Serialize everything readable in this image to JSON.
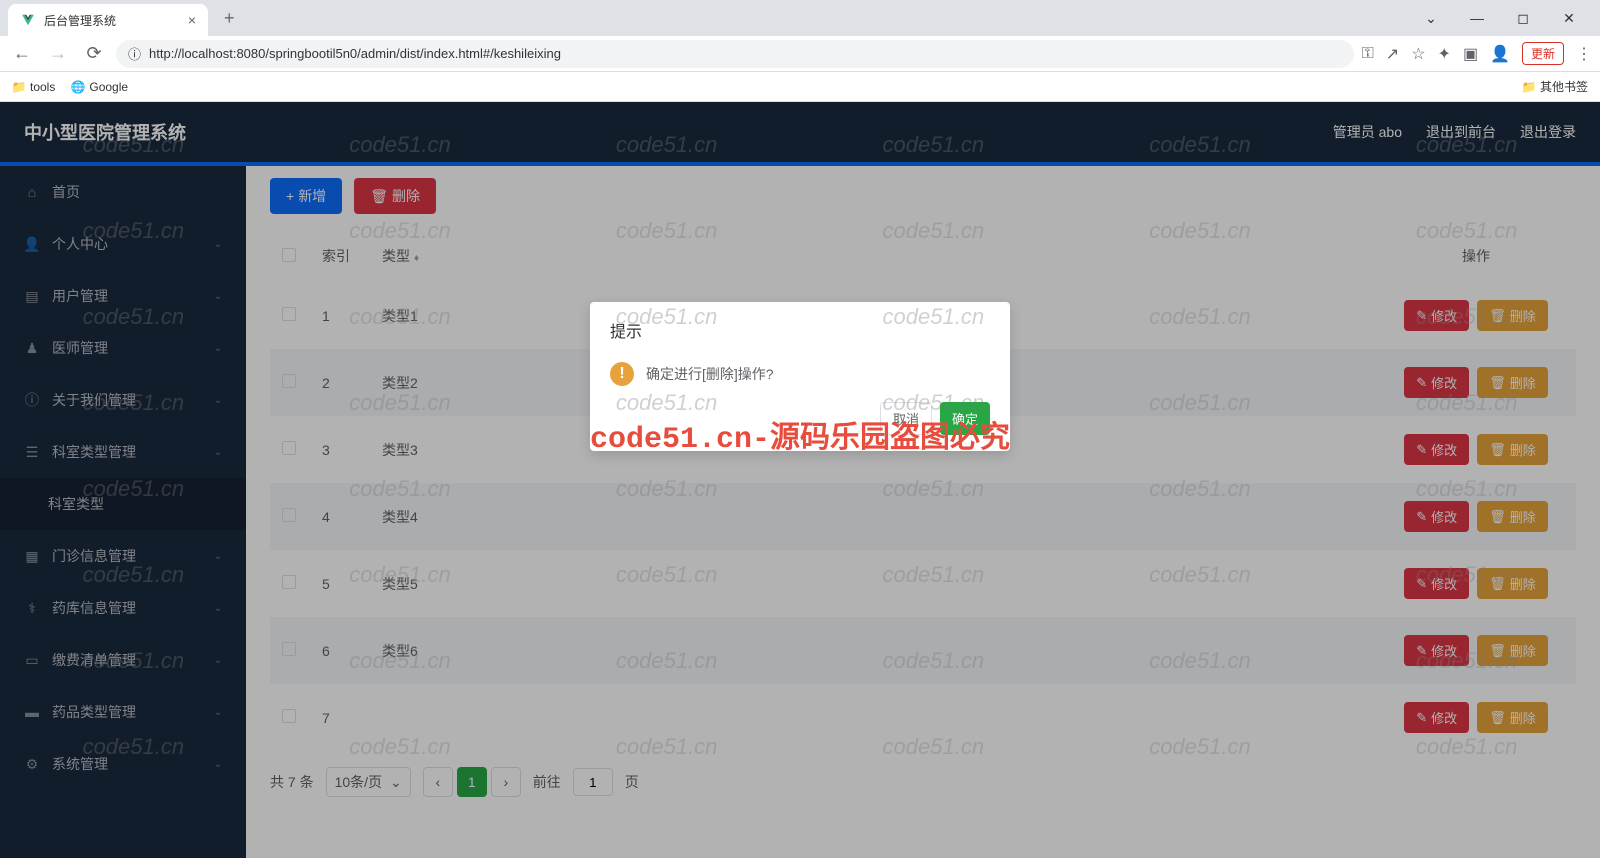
{
  "browser": {
    "tab_title": "后台管理系统",
    "url": "http://localhost:8080/springbootil5n0/admin/dist/index.html#/keshileixing",
    "update_btn": "更新",
    "bookmarks": {
      "tools": "tools",
      "google": "Google",
      "other": "其他书签"
    }
  },
  "header": {
    "title": "中小型医院管理系统",
    "user": "管理员 abo",
    "back_front": "退出到前台",
    "logout": "退出登录"
  },
  "sidebar": {
    "items": [
      {
        "icon": "home",
        "label": "首页"
      },
      {
        "icon": "user",
        "label": "个人中心",
        "expandable": true
      },
      {
        "icon": "users",
        "label": "用户管理",
        "expandable": true
      },
      {
        "icon": "doctor",
        "label": "医师管理",
        "expandable": true
      },
      {
        "icon": "info",
        "label": "关于我们管理",
        "expandable": true
      },
      {
        "icon": "list",
        "label": "科室类型管理",
        "expandable": true
      },
      {
        "icon": "",
        "label": "科室类型",
        "sub": true
      },
      {
        "icon": "doc",
        "label": "门诊信息管理",
        "expandable": true
      },
      {
        "icon": "med",
        "label": "药库信息管理",
        "expandable": true
      },
      {
        "icon": "bill",
        "label": "缴费清单管理",
        "expandable": true
      },
      {
        "icon": "pill",
        "label": "药品类型管理",
        "expandable": true
      },
      {
        "icon": "sys",
        "label": "系统管理",
        "expandable": true
      }
    ]
  },
  "toolbar": {
    "add_label": "新增",
    "delete_label": "删除"
  },
  "table": {
    "headers": {
      "index": "索引",
      "type": "类型",
      "action": "操作"
    },
    "btn_edit": "修改",
    "btn_delete": "删除",
    "rows": [
      {
        "idx": "1",
        "type": "类型1"
      },
      {
        "idx": "2",
        "type": "类型2"
      },
      {
        "idx": "3",
        "type": "类型3"
      },
      {
        "idx": "4",
        "type": "类型4"
      },
      {
        "idx": "5",
        "type": "类型5"
      },
      {
        "idx": "6",
        "type": "类型6"
      },
      {
        "idx": "7",
        "type": ""
      }
    ]
  },
  "pagination": {
    "total": "共 7 条",
    "per_page": "10条/页",
    "current": "1",
    "goto": "前往",
    "page_unit": "页",
    "goto_input": "1"
  },
  "modal": {
    "title": "提示",
    "message": "确定进行[删除]操作?",
    "cancel": "取消",
    "confirm": "确定"
  },
  "watermark": {
    "text": "code51.cn",
    "center": "code51.cn-源码乐园盗图必究"
  }
}
